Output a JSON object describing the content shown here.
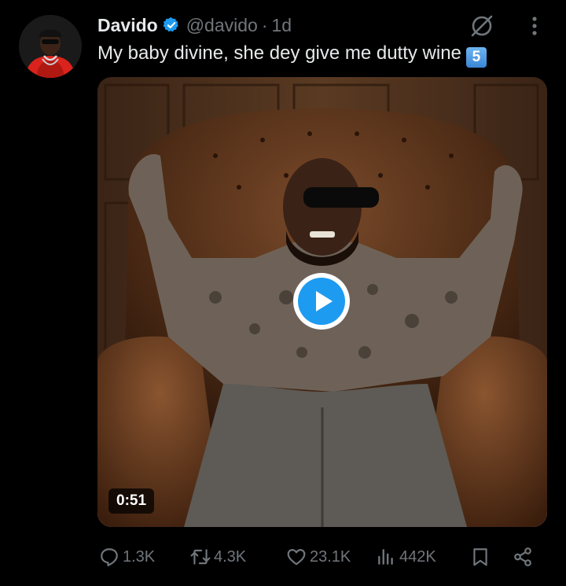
{
  "author": {
    "name": "Davido",
    "handle": "@davido",
    "separator": "·",
    "time": "1d"
  },
  "tweet": {
    "text": "My baby divine, she dey give me dutty wine",
    "emoji": "5"
  },
  "media": {
    "duration": "0:51"
  },
  "actions": {
    "replies": "1.3K",
    "retweets": "4.3K",
    "likes": "23.1K",
    "views": "442K"
  },
  "icons": {
    "verified": "verified-badge-icon",
    "grok": "grok-icon",
    "more": "more-icon",
    "play": "play-icon",
    "reply": "reply-icon",
    "retweet": "retweet-icon",
    "like": "heart-icon",
    "views": "views-icon",
    "bookmark": "bookmark-icon",
    "share": "share-icon"
  },
  "colors": {
    "background": "#000000",
    "text": "#e7e9ea",
    "secondary": "#71767b",
    "accent": "#1d9bf0"
  }
}
